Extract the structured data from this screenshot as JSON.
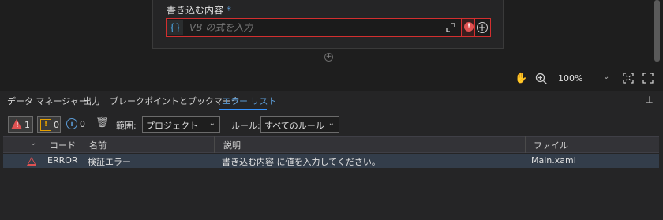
{
  "designer": {
    "field_label": "書き込む内容",
    "required_marker": "*",
    "brace_label": "{}",
    "expr_placeholder": "VB の式を入力",
    "error_badge": "!",
    "add_label": "+",
    "add_below_label": "+",
    "hand_glyph": "✋",
    "zoom": "100%",
    "zoom_chevron": "⌄"
  },
  "panel": {
    "tabs": [
      {
        "label": "データ マネージャー"
      },
      {
        "label": "出力"
      },
      {
        "label": "ブレークポイントとブックマーク"
      },
      {
        "label": "エラー リスト"
      }
    ],
    "active_tab": "エラー リスト",
    "pin_glyph": "⊥"
  },
  "toolbar": {
    "error_count": "1",
    "warning_count": "0",
    "info_count": "0",
    "scope_label": "範囲:",
    "scope_value": "プロジェクト",
    "rule_label": "ルール:",
    "rule_value": "すべてのルール",
    "chevron": "⌄",
    "trash_glyph": "🗑",
    "info_glyph": "i",
    "warning_glyph": "!",
    "error_glyph": "!"
  },
  "table": {
    "sort_glyph": "⌄",
    "headers": [
      "コード",
      "名前",
      "説明",
      "ファイル"
    ],
    "rows": [
      {
        "code": "ERROR",
        "name": "検証エラー",
        "description": "書き込む内容 に値を入力してください。",
        "file": "Main.xaml"
      }
    ]
  },
  "colors": {
    "accent": "#3794ff",
    "error": "#e05252",
    "warning": "#e5a000"
  }
}
